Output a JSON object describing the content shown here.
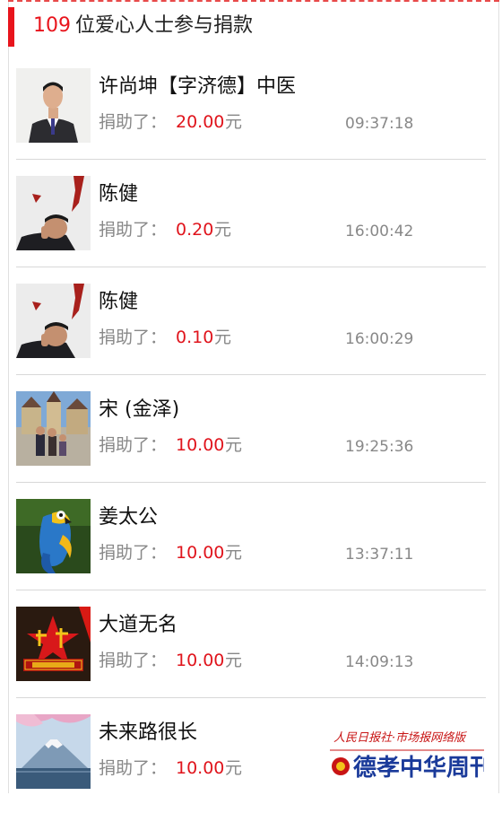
{
  "header": {
    "count": "109",
    "title": "位爱心人士参与捐款"
  },
  "donation_label": "捐助了：",
  "unit": "元",
  "donors": [
    {
      "name": "许尚坤【字济德】中医",
      "amount": "20.00",
      "time": "09:37:18",
      "avatar": "portrait-man-vest-icon"
    },
    {
      "name": "陈健",
      "amount": "0.20",
      "time": "16:00:42",
      "avatar": "portrait-man-thinking-icon"
    },
    {
      "name": "陈健",
      "amount": "0.10",
      "time": "16:00:29",
      "avatar": "portrait-man-thinking-icon"
    },
    {
      "name": "宋 (金泽)",
      "amount": "10.00",
      "time": "19:25:36",
      "avatar": "family-photo-castle-icon"
    },
    {
      "name": "姜太公",
      "amount": "10.00",
      "time": "13:37:11",
      "avatar": "parrot-icon"
    },
    {
      "name": "大道无名",
      "amount": "10.00",
      "time": "14:09:13",
      "avatar": "china-dream-star-icon"
    },
    {
      "name": "未来路很长",
      "amount": "10.00",
      "time": "",
      "avatar": "mount-fuji-icon"
    }
  ],
  "watermark": {
    "line1": "人民日报社·市场报网络版",
    "line2": "德孝中华周刊"
  },
  "colors": {
    "accent": "#e8141c",
    "text": "#111111",
    "muted": "#888888",
    "divider": "#d8d8d8"
  }
}
